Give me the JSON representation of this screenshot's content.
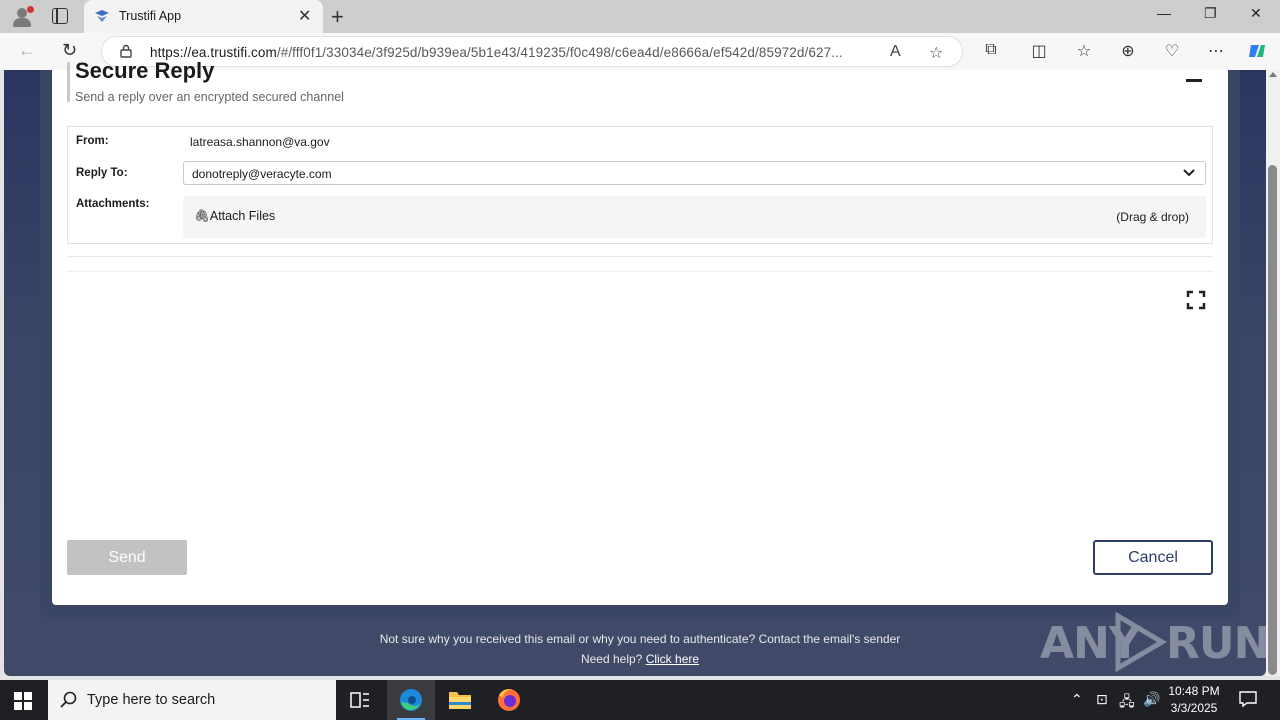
{
  "browser": {
    "tab_title": "Trustifi App",
    "url_host": "https://ea.trustifi.com",
    "url_path": "/#/fff0f1/33034e/3f925d/b939ea/5b1e43/419235/f0c498/c6ea4d/e8666a/ef542d/85972d/627..."
  },
  "secure_reply": {
    "title": "Secure Reply",
    "subtitle": "Send a reply over an encrypted secured channel",
    "from_label": "From:",
    "from_value": "latreasa.shannon@va.gov",
    "reply_to_label": "Reply To:",
    "reply_to_value": "donotreply@veracyte.com",
    "attachments_label": "Attachments:",
    "attach_files": "Attach Files",
    "drag_drop": "(Drag & drop)",
    "send_label": "Send",
    "cancel_label": "Cancel"
  },
  "footer": {
    "line1": "Not sure why you received this email or why you need to authenticate? Contact the email's sender",
    "need_help": "Need help?",
    "click_here": "Click here"
  },
  "watermark": {
    "left": "ANY",
    "right": "RUN"
  },
  "taskbar": {
    "search_placeholder": "Type here to search",
    "time": "10:48 PM",
    "date": "3/3/2025"
  },
  "colors": {
    "accent": "#2d3d6a",
    "page_bg": "#2a3660",
    "send_disabled": "#c2c2c2"
  }
}
